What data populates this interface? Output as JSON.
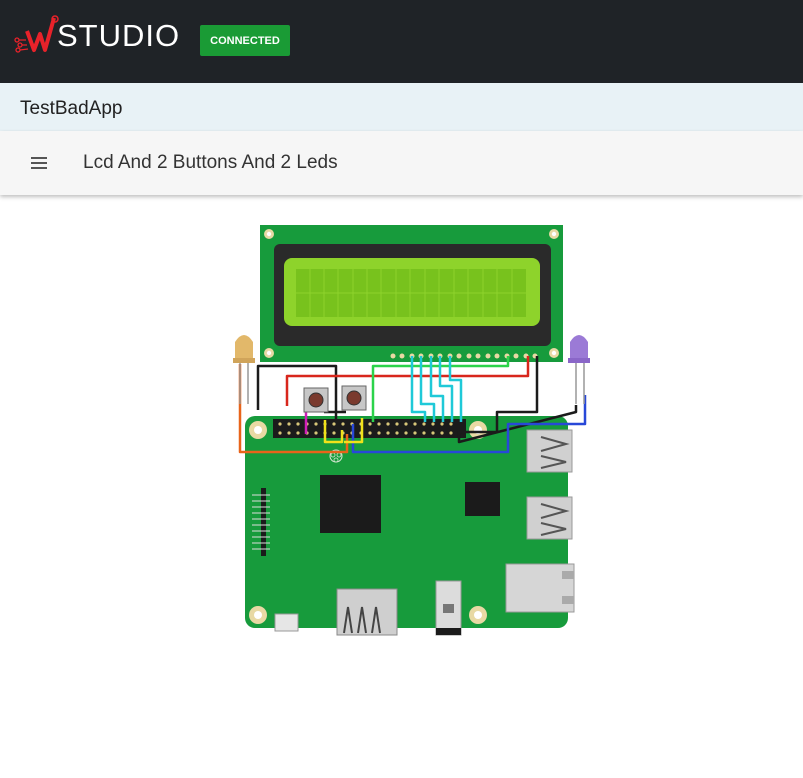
{
  "header": {
    "logo_letter": "W",
    "logo_text": "STUDIO",
    "status": "CONNECTED",
    "colors": {
      "bar": "#1f2327",
      "status": "#1a9b35",
      "logo_accent": "#e8222a"
    }
  },
  "app": {
    "title": "TestBadApp"
  },
  "page": {
    "title": "Lcd And 2 Buttons And 2 Leds",
    "menu_icon": "menu-icon"
  },
  "diagram": {
    "components": [
      "LCD display",
      "Raspberry Pi board",
      "push button",
      "push button",
      "yellow LED",
      "purple LED"
    ]
  }
}
